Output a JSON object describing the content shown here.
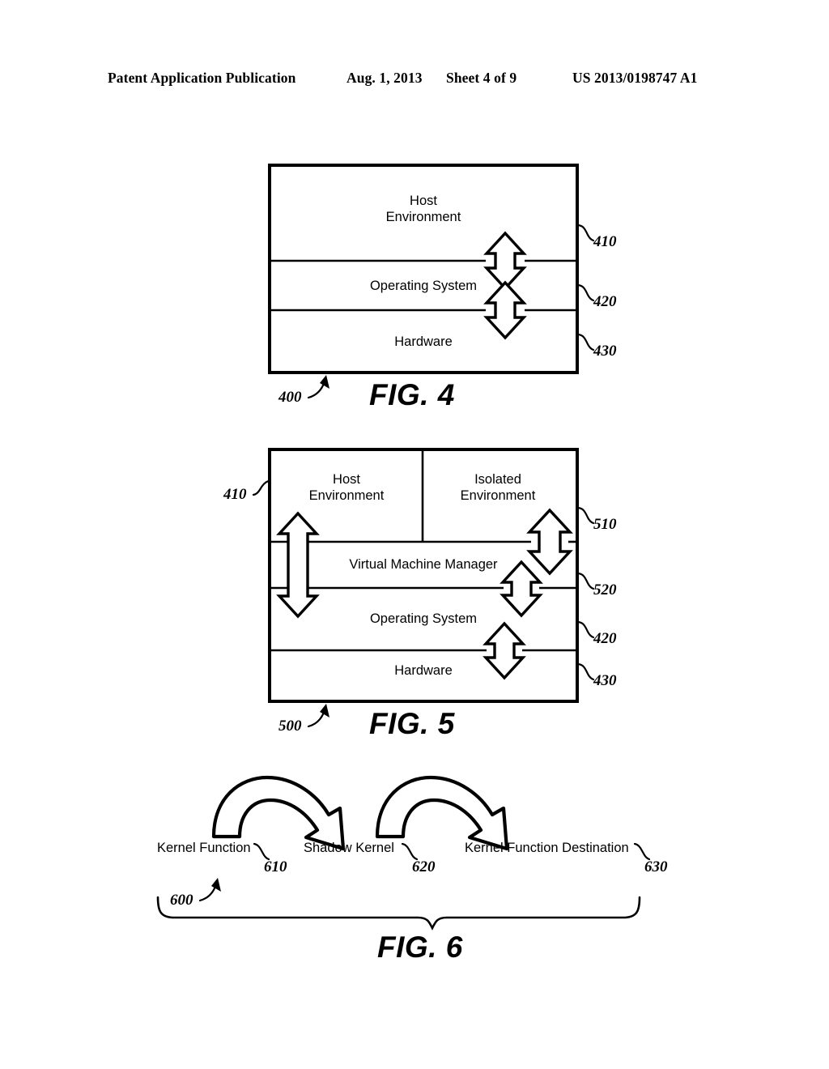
{
  "header": {
    "publication": "Patent Application Publication",
    "date": "Aug. 1, 2013",
    "sheet": "Sheet 4 of 9",
    "number": "US 2013/0198747 A1"
  },
  "figure4": {
    "title": "FIG. 4",
    "assembly_ref": "400",
    "bands": [
      {
        "label_line1": "Host",
        "label_line2": "Environment",
        "ref": "410"
      },
      {
        "label_line1": "Operating System",
        "label_line2": "",
        "ref": "420"
      },
      {
        "label_line1": "Hardware",
        "label_line2": "",
        "ref": "430"
      }
    ]
  },
  "figure5": {
    "title": "FIG. 5",
    "assembly_ref": "500",
    "left_ref": "410",
    "bands": [
      {
        "label_line1": "Host",
        "label_line2": "Environment",
        "ref": ""
      },
      {
        "label_line1": "Isolated",
        "label_line2": "Environment",
        "ref": "510"
      },
      {
        "label_line1": "Virtual Machine Manager",
        "label_line2": "",
        "ref": "520"
      },
      {
        "label_line1": "Operating System",
        "label_line2": "",
        "ref": "420"
      },
      {
        "label_line1": "Hardware",
        "label_line2": "",
        "ref": "430"
      }
    ]
  },
  "figure6": {
    "title": "FIG. 6",
    "assembly_ref": "600",
    "nodes": [
      {
        "label": "Kernel Function",
        "ref": "610"
      },
      {
        "label": "Shadow Kernel",
        "ref": "620"
      },
      {
        "label": "Kernel Function Destination",
        "ref": "630"
      }
    ]
  }
}
